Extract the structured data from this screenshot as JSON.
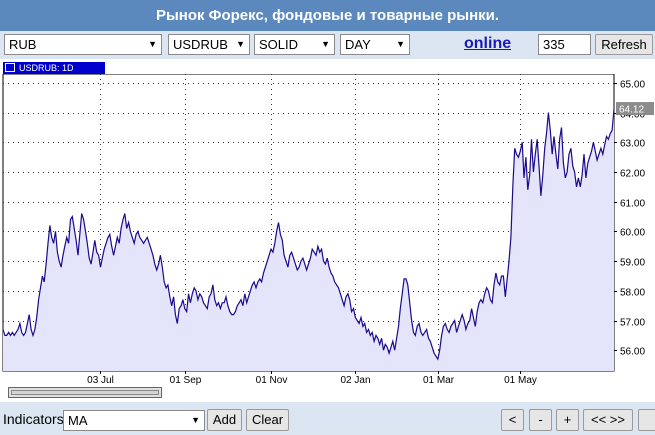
{
  "header": {
    "title": "Рынок Форекс, фондовые и товарные рынки."
  },
  "toolbar": {
    "market_select": "RUB",
    "symbol_select": "USDRUB",
    "style_select": "SOLID",
    "period_select": "DAY",
    "online_link": "online",
    "count_input": "335",
    "refresh_label": "Refresh"
  },
  "chart_tab": {
    "label": "USDRUB: 1D"
  },
  "bottom": {
    "indicators_label": "Indicators",
    "indicator_select": "MA",
    "add_label": "Add",
    "clear_label": "Clear",
    "nav": [
      "<",
      "-",
      "+",
      "<< >>"
    ]
  },
  "colors": {
    "line": "#1a0a8c",
    "fill": "#e4e4fa",
    "last_price_tag": "#8c8c8c",
    "title_bar": "#5b89be"
  },
  "chart_data": {
    "type": "area",
    "series_label": "USDRUB: 1D",
    "last_price": "64.12",
    "ylim": [
      55.3,
      65.3
    ],
    "y_ticks": [
      "65.00",
      "64.00",
      "63.00",
      "62.00",
      "61.00",
      "60.00",
      "59.00",
      "58.00",
      "57.00",
      "56.00"
    ],
    "x_ticks": [
      "03 Jul",
      "01 Sep",
      "01 Nov",
      "02 Jan",
      "01 Mar",
      "01 May"
    ],
    "x_tick_index": [
      52,
      97,
      143,
      188,
      232,
      276
    ],
    "grid": true,
    "values": [
      56.7,
      56.5,
      56.5,
      56.6,
      56.5,
      56.6,
      56.5,
      56.6,
      56.7,
      56.9,
      56.6,
      56.5,
      56.6,
      56.9,
      57.2,
      56.7,
      56.5,
      56.7,
      57.1,
      57.7,
      58.1,
      58.5,
      58.3,
      58.9,
      59.6,
      60.2,
      59.8,
      59.6,
      60.0,
      59.3,
      59.0,
      58.8,
      59.2,
      59.5,
      59.8,
      59.6,
      60.4,
      60.5,
      60.1,
      59.7,
      59.2,
      59.9,
      60.6,
      60.4,
      60.0,
      59.6,
      59.1,
      58.9,
      59.3,
      59.7,
      59.3,
      59.2,
      58.8,
      59.1,
      59.4,
      59.6,
      59.8,
      59.9,
      59.5,
      59.2,
      59.5,
      59.8,
      59.6,
      60.1,
      60.4,
      60.6,
      60.1,
      60.3,
      60.0,
      59.8,
      59.6,
      59.9,
      60.0,
      59.8,
      59.7,
      59.6,
      59.7,
      59.8,
      59.6,
      59.4,
      59.2,
      58.9,
      58.7,
      58.9,
      59.2,
      58.8,
      58.3,
      58.1,
      58.2,
      57.8,
      57.5,
      57.8,
      57.2,
      56.9,
      57.4,
      57.5,
      57.7,
      57.4,
      57.3,
      57.9,
      57.6,
      57.9,
      58.1,
      58.0,
      57.7,
      57.9,
      57.8,
      57.6,
      57.5,
      57.4,
      57.8,
      57.9,
      58.2,
      57.7,
      57.5,
      57.6,
      57.4,
      57.6,
      57.6,
      57.8,
      57.5,
      57.3,
      57.2,
      57.2,
      57.3,
      57.5,
      57.6,
      57.7,
      57.5,
      57.9,
      57.6,
      57.8,
      58.0,
      58.2,
      58.3,
      58.1,
      58.3,
      58.4,
      58.3,
      58.6,
      58.8,
      59.0,
      59.2,
      59.4,
      59.3,
      59.6,
      60.0,
      60.3,
      59.9,
      59.7,
      59.2,
      59.0,
      58.8,
      59.2,
      59.3,
      59.1,
      58.9,
      58.7,
      58.8,
      59.0,
      59.1,
      58.9,
      58.7,
      58.9,
      59.1,
      59.4,
      59.3,
      59.2,
      59.5,
      59.3,
      59.4,
      59.0,
      58.9,
      59.1,
      58.8,
      58.6,
      58.5,
      58.3,
      58.2,
      58.1,
      57.9,
      57.7,
      57.5,
      57.8,
      57.9,
      57.7,
      57.3,
      57.4,
      57.1,
      57.0,
      56.9,
      57.1,
      56.8,
      56.9,
      56.6,
      56.7,
      56.5,
      56.6,
      56.3,
      56.5,
      56.4,
      56.2,
      56.4,
      56.0,
      56.2,
      56.1,
      55.9,
      56.1,
      56.3,
      56.0,
      56.4,
      56.8,
      57.4,
      57.9,
      58.4,
      58.4,
      58.2,
      57.6,
      57.0,
      56.6,
      56.5,
      56.8,
      56.9,
      56.6,
      56.5,
      56.6,
      56.7,
      56.4,
      56.3,
      56.1,
      55.9,
      55.8,
      55.7,
      56.0,
      56.5,
      56.8,
      56.9,
      56.7,
      56.6,
      56.8,
      56.9,
      57.0,
      56.6,
      56.8,
      57.0,
      57.2,
      57.0,
      56.7,
      56.9,
      57.0,
      57.4,
      57.1,
      56.8,
      57.3,
      57.6,
      57.7,
      57.6,
      57.9,
      58.1,
      58.0,
      57.7,
      57.6,
      58.2,
      58.6,
      58.3,
      58.2,
      58.5,
      58.5,
      57.8,
      58.4,
      59.0,
      59.8,
      61.5,
      62.8,
      62.6,
      62.5,
      62.7,
      63.0,
      61.8,
      62.5,
      61.4,
      61.9,
      63.1,
      62.0,
      62.6,
      63.1,
      62.2,
      61.2,
      61.9,
      62.8,
      63.3,
      64.0,
      63.4,
      62.6,
      63.2,
      62.6,
      62.1,
      63.1,
      63.5,
      62.3,
      61.8,
      62.0,
      62.6,
      62.8,
      62.2,
      62.0,
      61.5,
      61.8,
      61.5,
      61.9,
      62.6,
      61.8,
      62.3,
      62.5,
      62.7,
      63.0,
      62.7,
      62.4,
      62.6,
      62.8,
      62.6,
      62.9,
      63.2,
      63.1,
      63.3,
      63.4,
      64.12
    ]
  }
}
